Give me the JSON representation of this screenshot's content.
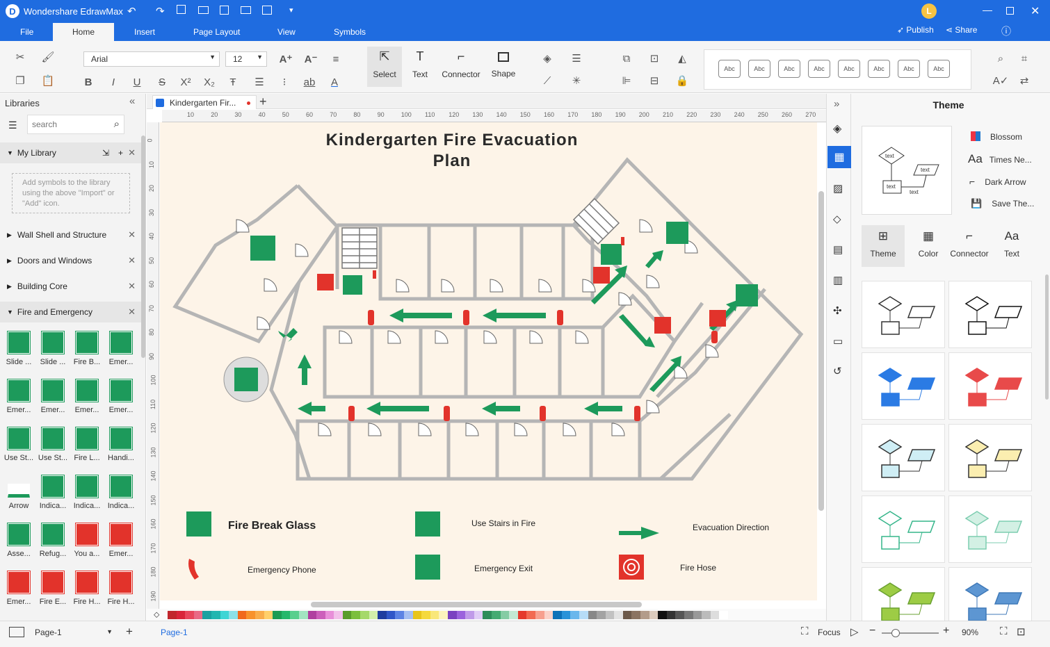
{
  "app": {
    "title": "Wondershare EdrawMax",
    "user_initial": "L"
  },
  "menu": {
    "items": [
      "File",
      "Home",
      "Insert",
      "Page Layout",
      "View",
      "Symbols"
    ],
    "active": "Home",
    "publish": "Publish",
    "share": "Share"
  },
  "ribbon": {
    "font_name": "Arial",
    "font_size": "12",
    "tools": {
      "select": "Select",
      "text": "Text",
      "connector": "Connector",
      "shape": "Shape"
    },
    "styles": [
      "Abc",
      "Abc",
      "Abc",
      "Abc",
      "Abc",
      "Abc",
      "Abc",
      "Abc"
    ]
  },
  "libraries": {
    "title": "Libraries",
    "search_placeholder": "search",
    "my_library": "My Library",
    "my_library_hint": "Add symbols to the library using the above \"Import\" or \"Add\" icon.",
    "sections": [
      "Wall Shell and Structure",
      "Doors and Windows",
      "Building Core",
      "Fire and Emergency"
    ],
    "symbols": [
      "Slide ...",
      "Slide ...",
      "Fire B...",
      "Emer...",
      "Emer...",
      "Emer...",
      "Emer...",
      "Emer...",
      "Use St...",
      "Use St...",
      "Fire L...",
      "Handi...",
      "Arrow",
      "Indica...",
      "Indica...",
      "Indica...",
      "Asse...",
      "Refug...",
      "You a...",
      "Emer...",
      "Emer...",
      "Fire E...",
      "Fire H...",
      "Fire H..."
    ]
  },
  "document": {
    "tab": "Kindergarten Fir...",
    "title_line1": "Kindergarten Fire Evacuation",
    "title_line2": "Plan"
  },
  "ruler": {
    "top": [
      "10",
      "20",
      "30",
      "40",
      "50",
      "60",
      "70",
      "80",
      "90",
      "100",
      "110",
      "120",
      "130",
      "140",
      "150",
      "160",
      "170",
      "180",
      "190",
      "200",
      "210",
      "220",
      "230",
      "240",
      "250",
      "260",
      "270",
      "280"
    ],
    "left": [
      "0",
      "10",
      "20",
      "30",
      "40",
      "50",
      "60",
      "70",
      "80",
      "90",
      "100",
      "110",
      "120",
      "130",
      "140",
      "150",
      "160",
      "170",
      "180",
      "190",
      "200"
    ]
  },
  "legend": {
    "fire_break_glass": "Fire Break Glass",
    "use_stairs": "Use Stairs in Fire",
    "evac_direction": "Evacuation Direction",
    "emergency_phone": "Emergency Phone",
    "emergency_exit": "Emergency Exit",
    "fire_hose": "Fire Hose"
  },
  "theme_panel": {
    "title": "Theme",
    "options": [
      "Blossom",
      "Times Ne...",
      "Dark Arrow",
      "Save The..."
    ],
    "tabs": [
      "Theme",
      "Color",
      "Connector",
      "Text"
    ],
    "preview_labels": [
      "text",
      "text",
      "text",
      "text"
    ]
  },
  "status": {
    "page_selector": "Page-1",
    "page_tab": "Page-1",
    "focus": "Focus",
    "zoom": "90%"
  },
  "colors": {
    "accent": "#1f6ce0",
    "emergency_green": "#1d9a5b",
    "fire_red": "#e2332b",
    "wall": "#b5b5b5",
    "canvas_bg": "#fdf4e8"
  }
}
